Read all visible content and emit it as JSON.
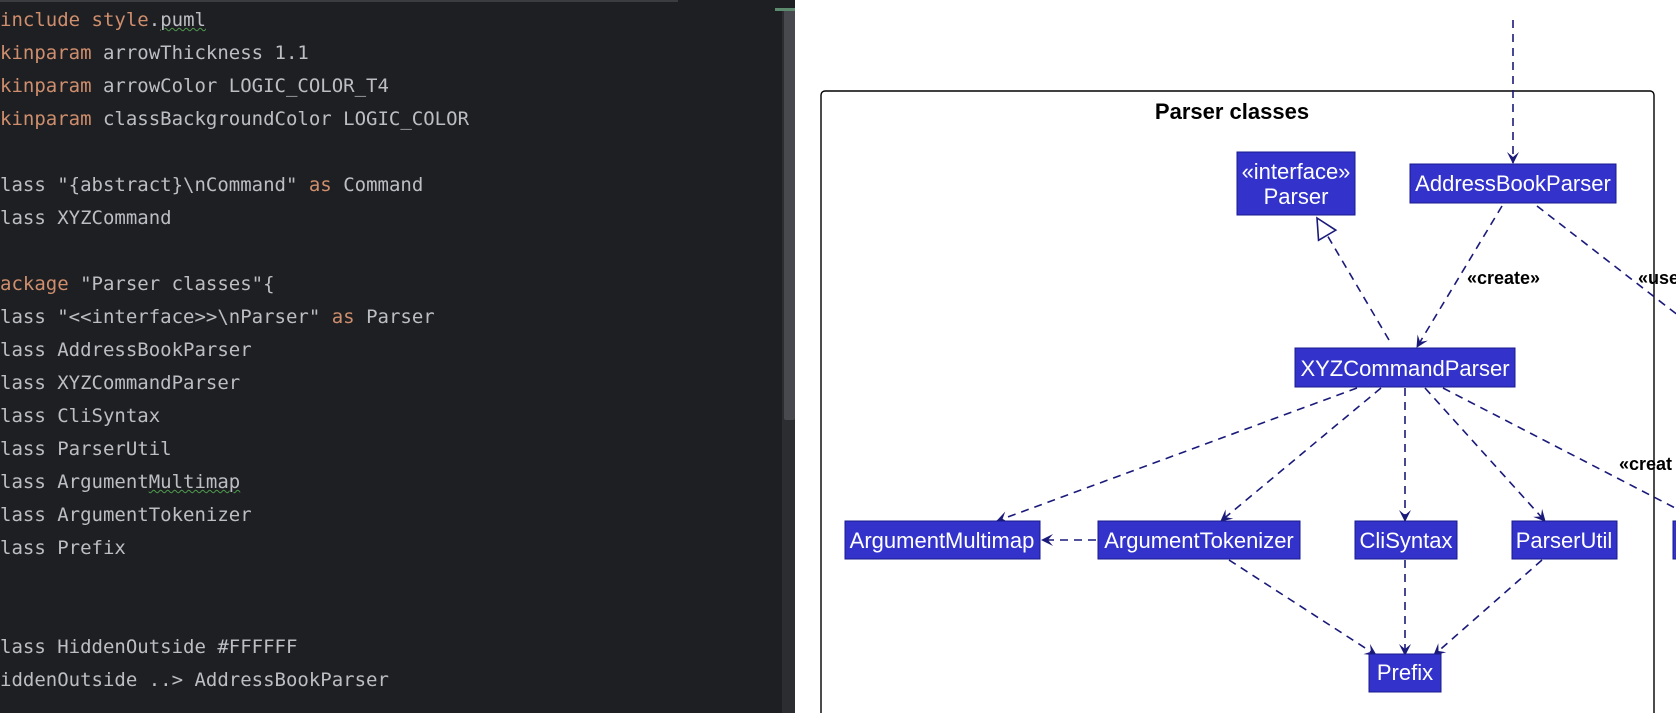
{
  "editor": {
    "lines": [
      [
        {
          "t": "include",
          "k": "kw"
        },
        {
          "t": " "
        },
        {
          "t": "style",
          "k": "kw"
        },
        {
          "t": "."
        },
        {
          "t": "puml",
          "k": "sq"
        }
      ],
      [
        {
          "t": "kinparam",
          "k": "kw"
        },
        {
          "t": " arrowThickness 1.1"
        }
      ],
      [
        {
          "t": "kinparam",
          "k": "kw"
        },
        {
          "t": " arrowColor LOGIC_COLOR_T4"
        }
      ],
      [
        {
          "t": "kinparam",
          "k": "kw"
        },
        {
          "t": " classBackgroundColor LOGIC_COLOR"
        }
      ],
      [],
      [
        {
          "t": "lass \"{abstract}\\nCommand\" "
        },
        {
          "t": "as",
          "k": "kw"
        },
        {
          "t": " Command"
        }
      ],
      [
        {
          "t": "lass XYZCommand"
        }
      ],
      [],
      [
        {
          "t": "ackage",
          "k": "kw"
        },
        {
          "t": " \"Parser classes\"{"
        }
      ],
      [
        {
          "t": "lass \"<<interface>>\\nParser\" "
        },
        {
          "t": "as",
          "k": "kw"
        },
        {
          "t": " Parser"
        }
      ],
      [
        {
          "t": "lass AddressBookParser"
        }
      ],
      [
        {
          "t": "lass XYZCommandParser"
        }
      ],
      [
        {
          "t": "lass CliSyntax"
        }
      ],
      [
        {
          "t": "lass ParserUtil"
        }
      ],
      [
        {
          "t": "lass Argument"
        },
        {
          "t": "Multimap",
          "k": "sq"
        }
      ],
      [
        {
          "t": "lass ArgumentTokenizer"
        }
      ],
      [
        {
          "t": "lass Prefix"
        }
      ],
      [],
      [],
      [
        {
          "t": "lass HiddenOutside #FFFFFF"
        }
      ],
      [
        {
          "t": "iddenOutside ..> AddressBookParser"
        }
      ]
    ]
  },
  "diagram": {
    "package_title": "Parser classes",
    "nodes": {
      "parser": [
        "«interface»",
        "Parser"
      ],
      "addressbookparser": "AddressBookParser",
      "xyzcommandparser": "XYZCommandParser",
      "argumentmultimap": "ArgumentMultimap",
      "argumenttokenizer": "ArgumentTokenizer",
      "clisyntax": "CliSyntax",
      "parserutil": "ParserUtil",
      "prefix": "Prefix"
    },
    "edge_labels": {
      "create_xyz": "«create»",
      "use_clipped": "«use",
      "create_clipped": "«creat"
    },
    "colors": {
      "node_fill": "#3333cc",
      "edge": "#1a1a7a",
      "keyword": "#cf8e6d",
      "editor_bg": "#1e1f22"
    }
  }
}
